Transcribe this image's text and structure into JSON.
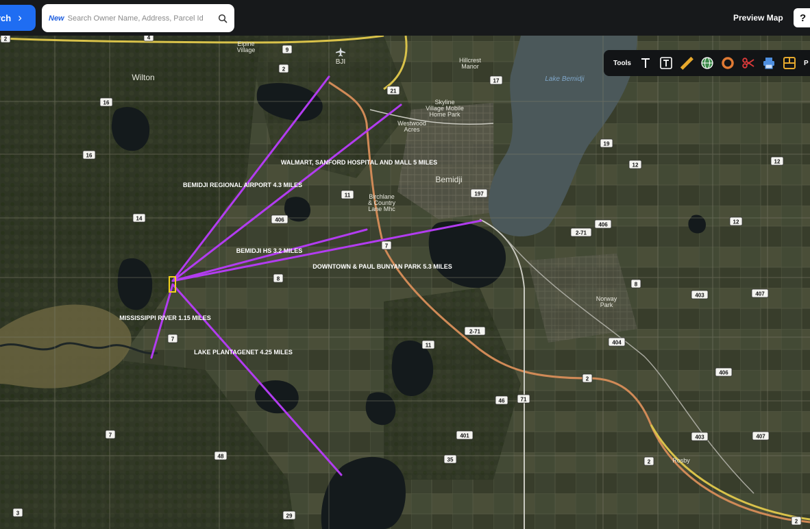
{
  "topbar": {
    "search_button_label": "rch",
    "new_badge": "New",
    "search_placeholder": "Search Owner Name, Address, Parcel Id",
    "preview_map_label": "Preview Map",
    "help_label": "?"
  },
  "tools": {
    "label": "Tools",
    "items": [
      "text-tool-icon",
      "text-box-tool-icon",
      "ruler-icon",
      "globe-icon",
      "circle-tool-icon",
      "scissors-icon",
      "print-icon",
      "layout-icon"
    ],
    "extra_label": "P"
  },
  "map": {
    "place_labels": [
      {
        "text": "Wilton"
      },
      {
        "text": "Eipine"
      },
      {
        "text": "Village"
      },
      {
        "text": "BJI"
      },
      {
        "text": "Hillcrest"
      },
      {
        "text": "Manor"
      },
      {
        "text": "Skyline"
      },
      {
        "text": "Village Mobile"
      },
      {
        "text": "Home Park"
      },
      {
        "text": "Westwood"
      },
      {
        "text": "Acres"
      },
      {
        "text": "Bemidji"
      },
      {
        "text": "Birchlane"
      },
      {
        "text": "& Country"
      },
      {
        "text": "Lane Mhc"
      },
      {
        "text": "Norway"
      },
      {
        "text": "Park"
      },
      {
        "text": "Rosby"
      },
      {
        "text": "Lake Bemidji"
      }
    ],
    "distance_labels": [
      {
        "text": "WALMART, SANFORD HOSPITAL AND MALL 5 MILES"
      },
      {
        "text": "BEMIDJI REGIONAL AIRPORT 4.3 MILES"
      },
      {
        "text": "BEMIDJI HS 3.2 MILES"
      },
      {
        "text": "DOWNTOWN & PAUL BUNYAN PARK 5.3 MILES"
      },
      {
        "text": "MISSISSIPPI RIVER 1.15 MILES"
      },
      {
        "text": "LAKE PLANTAGENET 4.25 MILES"
      }
    ],
    "road_shields": [
      "2",
      "4",
      "9",
      "2",
      "21",
      "17",
      "16",
      "16",
      "19",
      "12",
      "12",
      "11",
      "197",
      "14",
      "406",
      "406",
      "12",
      "2-71",
      "7",
      "8",
      "8",
      "403",
      "407",
      "7",
      "2-71",
      "404",
      "11",
      "406",
      "2",
      "46",
      "71",
      "401",
      "403",
      "407",
      "7",
      "48",
      "35",
      "2",
      "3",
      "29",
      "2"
    ],
    "colors": {
      "route_line": "#b23cf0",
      "highway": "#d9c24a",
      "us_route": "#d08a57",
      "water": "#141a1c",
      "lake_bemidji": "#4c5a5c"
    }
  }
}
